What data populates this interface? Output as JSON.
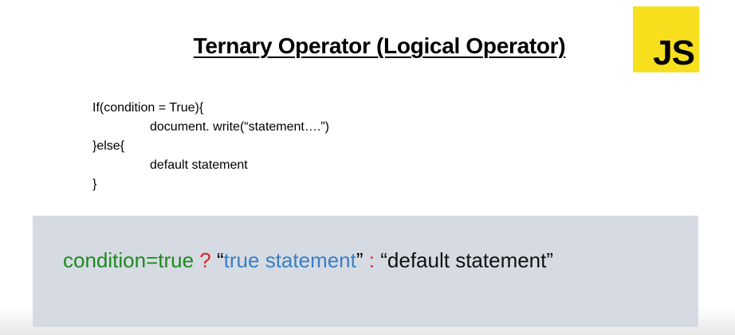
{
  "slide": {
    "title": "Ternary Operator (Logical Operator)",
    "logo_text": "JS",
    "logo_color": "#f7df1e"
  },
  "code": {
    "lines": [
      "If(condition = True){",
      "document. write(“statement….”)",
      "}else{",
      "default statement",
      "}"
    ]
  },
  "ternary": {
    "condition": "condition=true",
    "question_mark": "?",
    "open_quote_true": "“",
    "true_statement": "true statement",
    "close_quote_true": "”",
    "colon": ":",
    "default_statement": "“default statement”",
    "colors": {
      "condition": "#1e8a1e",
      "operator": "#e02020",
      "true_statement": "#3a7fc4",
      "default_statement": "#111111"
    }
  }
}
